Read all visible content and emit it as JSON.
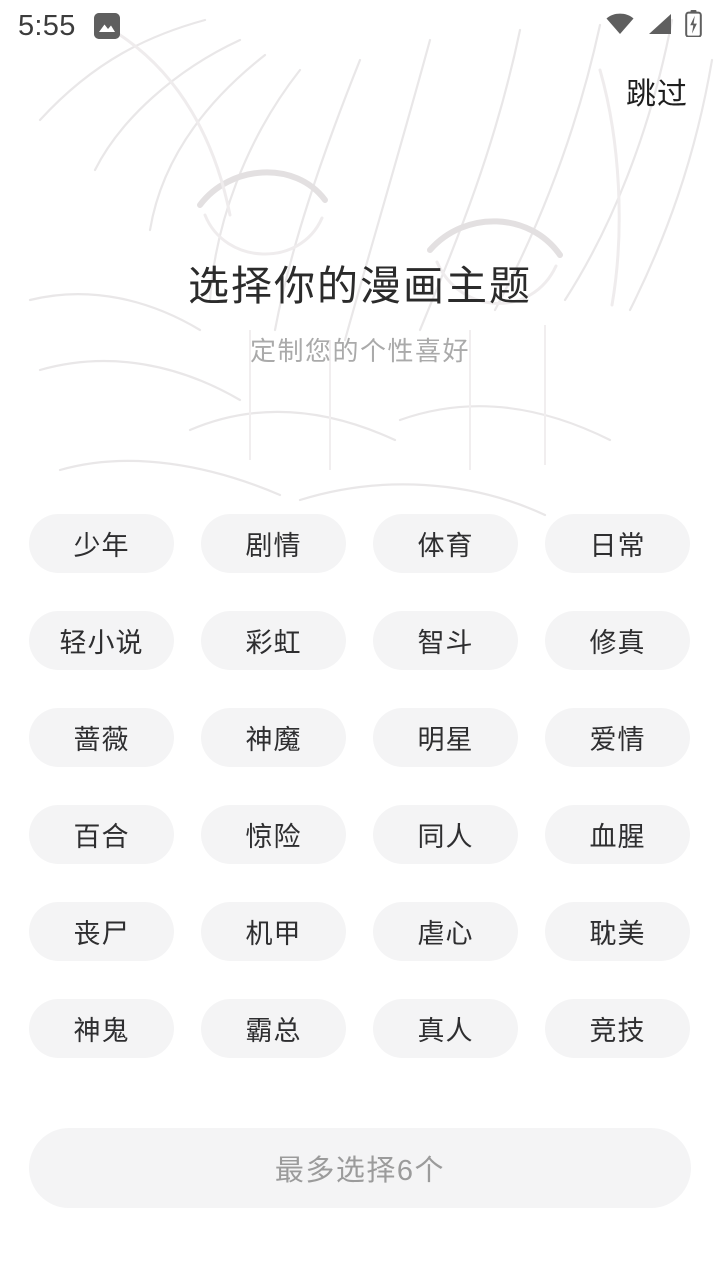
{
  "status_bar": {
    "time": "5:55",
    "left_icons": [
      "gallery-icon"
    ],
    "right_icons": [
      "wifi-icon",
      "cellular-signal-icon",
      "battery-charging-icon"
    ]
  },
  "header": {
    "skip_label": "跳过"
  },
  "main": {
    "title": "选择你的漫画主题",
    "subtitle": "定制您的个性喜好"
  },
  "tags": [
    {
      "label": "少年",
      "selected": false
    },
    {
      "label": "剧情",
      "selected": false
    },
    {
      "label": "体育",
      "selected": false
    },
    {
      "label": "日常",
      "selected": false
    },
    {
      "label": "轻小说",
      "selected": false
    },
    {
      "label": "彩虹",
      "selected": false
    },
    {
      "label": "智斗",
      "selected": false
    },
    {
      "label": "修真",
      "selected": false
    },
    {
      "label": "蔷薇",
      "selected": false
    },
    {
      "label": "神魔",
      "selected": false
    },
    {
      "label": "明星",
      "selected": false
    },
    {
      "label": "爱情",
      "selected": false
    },
    {
      "label": "百合",
      "selected": false
    },
    {
      "label": "惊险",
      "selected": false
    },
    {
      "label": "同人",
      "selected": false
    },
    {
      "label": "血腥",
      "selected": false
    },
    {
      "label": "丧尸",
      "selected": false
    },
    {
      "label": "机甲",
      "selected": false
    },
    {
      "label": "虐心",
      "selected": false
    },
    {
      "label": "耽美",
      "selected": false
    },
    {
      "label": "神鬼",
      "selected": false
    },
    {
      "label": "霸总",
      "selected": false
    },
    {
      "label": "真人",
      "selected": false
    },
    {
      "label": "竞技",
      "selected": false
    }
  ],
  "footer": {
    "confirm_label": "最多选择6个",
    "max_selection": 6
  },
  "colors": {
    "page_background": "#ffffff",
    "chip_background": "#f4f4f5",
    "chip_text": "#2e2e30",
    "title_text": "#2b2b2b",
    "subtitle_text": "#aaaaaa",
    "confirm_text": "#9b9b9b",
    "status_icon": "#5f5f5f"
  }
}
